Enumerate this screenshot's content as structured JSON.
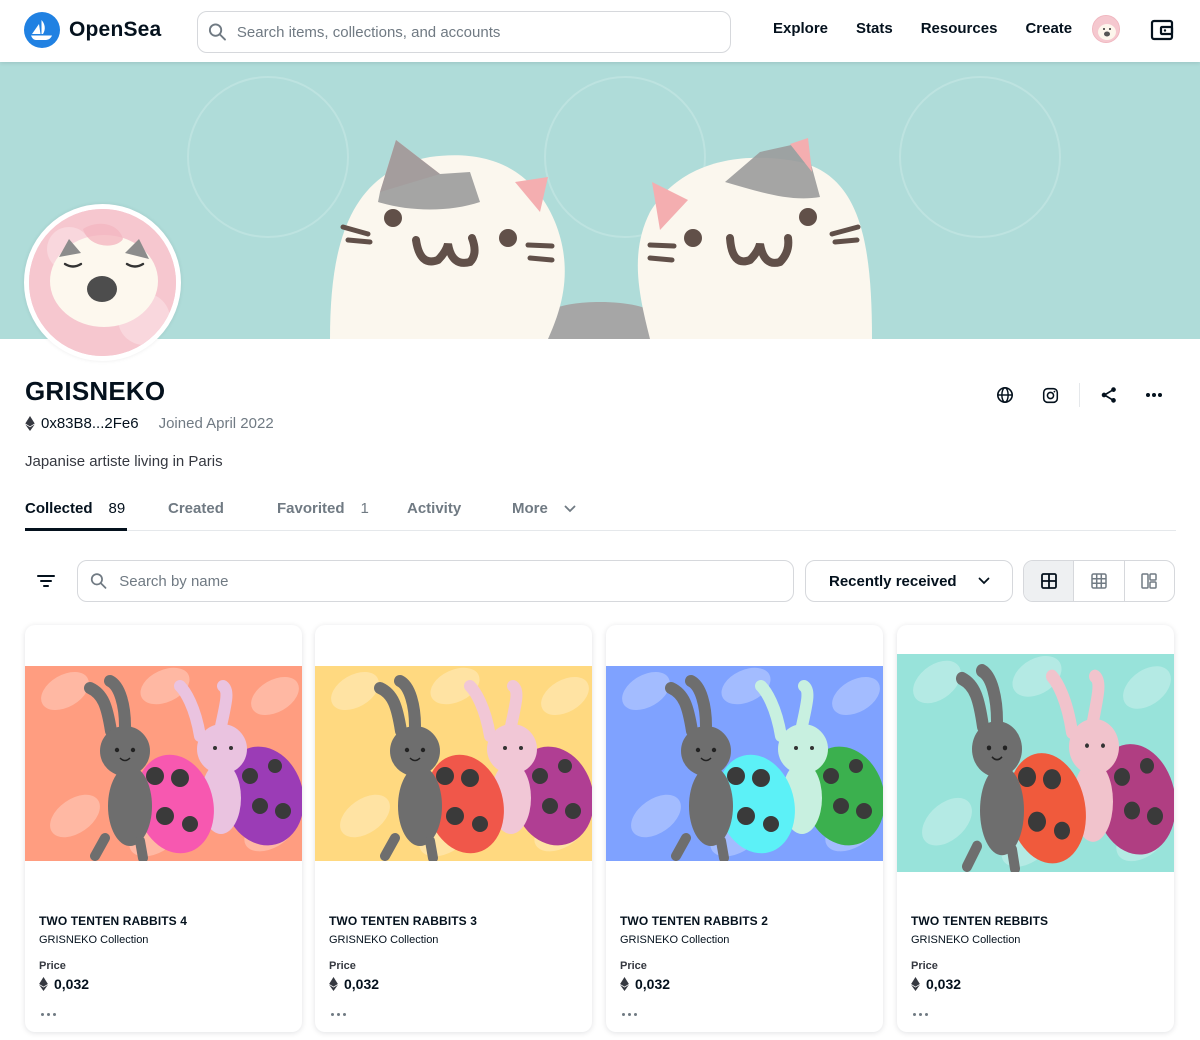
{
  "app": {
    "name": "OpenSea",
    "brand_color": "#2081e2"
  },
  "nav": {
    "search_placeholder": "Search items, collections, and accounts",
    "links": [
      "Explore",
      "Stats",
      "Resources",
      "Create"
    ],
    "icons": [
      "search-icon",
      "avatar",
      "wallet-icon"
    ]
  },
  "banner": {
    "background_color": "#afdcd9"
  },
  "profile": {
    "name": "GRISNEKO",
    "address": "0x83B8...2Fe6",
    "joined": "Joined April 2022",
    "bio": "Japanise artiste living in Paris",
    "actions": [
      "globe-icon",
      "instagram-icon",
      "share-icon",
      "more-icon"
    ]
  },
  "tabs": [
    {
      "label": "Collected",
      "count": "89",
      "active": true
    },
    {
      "label": "Created",
      "count": ""
    },
    {
      "label": "Favorited",
      "count": "1"
    },
    {
      "label": "Activity",
      "count": ""
    },
    {
      "label": "More",
      "count": ""
    }
  ],
  "filters": {
    "search_placeholder": "Search by name",
    "sort_selected": "Recently received",
    "view_modes": [
      "large-grid-icon",
      "small-grid-icon",
      "mosaic-icon"
    ],
    "active_view": 0
  },
  "cards": [
    {
      "title": "TWO TENTEN RABBITS 4",
      "collection": "GRISNEKO Collection",
      "price_label": "Price",
      "price": "0,032",
      "bg": "#ff9d80",
      "left_bug": "#f758b0",
      "right_bug": "#9b3cb6",
      "right_rabbit": "#eac3e0"
    },
    {
      "title": "TWO TENTEN RABBITS 3",
      "collection": "GRISNEKO Collection",
      "price_label": "Price",
      "price": "0,032",
      "bg": "#ffd980",
      "left_bug": "#f0574a",
      "right_bug": "#b03e93",
      "right_rabbit": "#f1c7d6"
    },
    {
      "title": "TWO TENTEN RABBITS 2",
      "collection": "GRISNEKO Collection",
      "price_label": "Price",
      "price": "0,032",
      "bg": "#7fa2ff",
      "left_bug": "#5cf1f7",
      "right_bug": "#3bb04e",
      "right_rabbit": "#c8f0e0"
    },
    {
      "title": "TWO TENTEN REBBITS",
      "collection": "GRISNEKO Collection",
      "price_label": "Price",
      "price": "0,032",
      "bg": "#98e3da",
      "left_bug": "#f05a3c",
      "right_bug": "#b03e82",
      "right_rabbit": "#f1c3cc"
    }
  ]
}
